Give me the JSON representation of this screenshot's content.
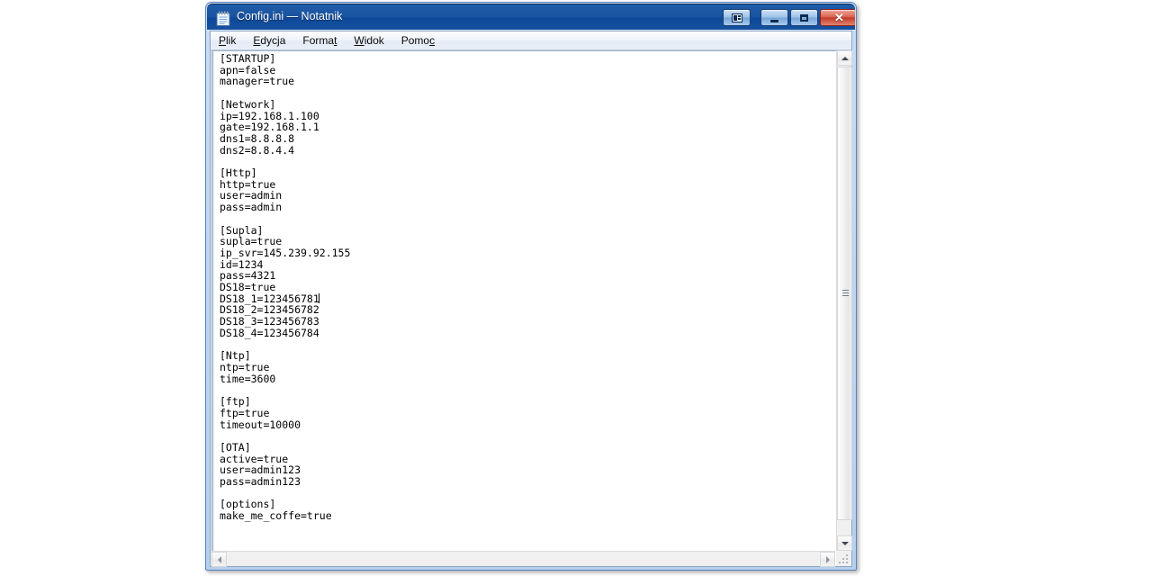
{
  "window": {
    "title": "Config.ini — Notatnik",
    "icon": "notepad-icon",
    "controls": {
      "extra_label": "",
      "minimize_label": "",
      "maximize_label": "",
      "close_label": "✕"
    }
  },
  "menubar": {
    "items": [
      {
        "label": "Plik",
        "accel_index": 0
      },
      {
        "label": "Edycja",
        "accel_index": 0
      },
      {
        "label": "Format",
        "accel_index": 5
      },
      {
        "label": "Widok",
        "accel_index": 0
      },
      {
        "label": "Pomoc",
        "accel_index": 4
      }
    ]
  },
  "editor": {
    "filename": "Config.ini",
    "content_before_caret": "[STARTUP]\napn=false\nmanager=true\n\n[Network]\nip=192.168.1.100\ngate=192.168.1.1\ndns1=8.8.8.8\ndns2=8.8.4.4\n\n[Http]\nhttp=true\nuser=admin\npass=admin\n\n[Supla]\nsupla=true\nip_svr=145.239.92.155\nid=1234\npass=4321\nDS18=true\nDS18_1=123456781",
    "content_after_caret": "\nDS18_2=123456782\nDS18_3=123456783\nDS18_4=123456784\n\n[Ntp]\nntp=true\ntime=3600\n\n[ftp]\nftp=true\ntimeout=10000\n\n[OTA]\nactive=true\nuser=admin123\npass=admin123\n\n[options]\nmake_me_coffe=true",
    "sections": [
      {
        "name": "[STARTUP]",
        "entries": [
          {
            "key": "apn",
            "value": "false"
          },
          {
            "key": "manager",
            "value": "true"
          }
        ]
      },
      {
        "name": "[Network]",
        "entries": [
          {
            "key": "ip",
            "value": "192.168.1.100"
          },
          {
            "key": "gate",
            "value": "192.168.1.1"
          },
          {
            "key": "dns1",
            "value": "8.8.8.8"
          },
          {
            "key": "dns2",
            "value": "8.8.4.4"
          }
        ]
      },
      {
        "name": "[Http]",
        "entries": [
          {
            "key": "http",
            "value": "true"
          },
          {
            "key": "user",
            "value": "admin"
          },
          {
            "key": "pass",
            "value": "admin"
          }
        ]
      },
      {
        "name": "[Supla]",
        "entries": [
          {
            "key": "supla",
            "value": "true"
          },
          {
            "key": "ip_svr",
            "value": "145.239.92.155"
          },
          {
            "key": "id",
            "value": "1234"
          },
          {
            "key": "pass",
            "value": "4321"
          },
          {
            "key": "DS18",
            "value": "true"
          },
          {
            "key": "DS18_1",
            "value": "123456781"
          },
          {
            "key": "DS18_2",
            "value": "123456782"
          },
          {
            "key": "DS18_3",
            "value": "123456783"
          },
          {
            "key": "DS18_4",
            "value": "123456784"
          }
        ]
      },
      {
        "name": "[Ntp]",
        "entries": [
          {
            "key": "ntp",
            "value": "true"
          },
          {
            "key": "time",
            "value": "3600"
          }
        ]
      },
      {
        "name": "[ftp]",
        "entries": [
          {
            "key": "ftp",
            "value": "true"
          },
          {
            "key": "timeout",
            "value": "10000"
          }
        ]
      },
      {
        "name": "[OTA]",
        "entries": [
          {
            "key": "active",
            "value": "true"
          },
          {
            "key": "user",
            "value": "admin123"
          },
          {
            "key": "pass",
            "value": "admin123"
          }
        ]
      },
      {
        "name": "[options]",
        "entries": [
          {
            "key": "make_me_coffe",
            "value": "true"
          }
        ]
      }
    ]
  },
  "scrollbars": {
    "vertical": {
      "position": "top",
      "thumb_ratio": "0.90"
    },
    "horizontal": {
      "position": "left",
      "thumb_ratio": "1.0"
    }
  },
  "colors": {
    "titlebar": "#1a54a0",
    "close_button": "#c33a26",
    "window_border": "#b6cfec",
    "editor_background": "#ffffff",
    "editor_text": "#000000"
  }
}
